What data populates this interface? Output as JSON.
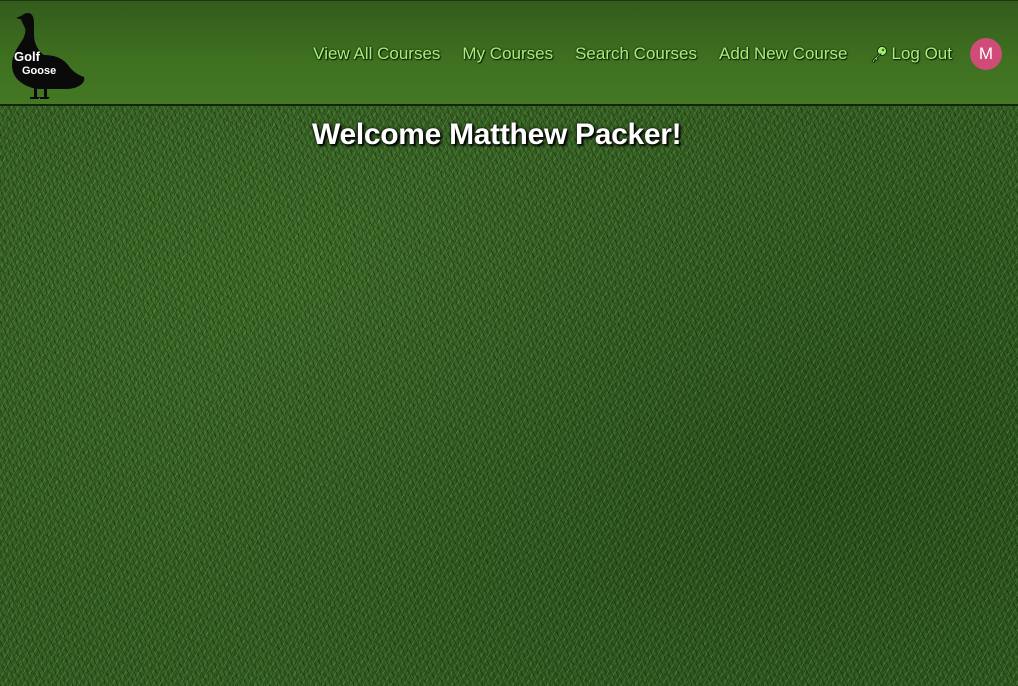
{
  "brand": {
    "logo_text_line1": "Golf",
    "logo_text_line2": "Goose"
  },
  "nav": {
    "items": [
      {
        "label": "View All Courses"
      },
      {
        "label": "My Courses"
      },
      {
        "label": "Search Courses"
      },
      {
        "label": "Add New Course"
      }
    ],
    "logout_label": "Log Out",
    "logout_icon": "key-icon",
    "avatar_initial": "M"
  },
  "main": {
    "welcome_text": "Welcome Matthew Packer!"
  },
  "colors": {
    "nav_background": "#3e7020",
    "nav_link": "#a6f07a",
    "avatar_background": "#cf4b78",
    "welcome_text": "#ffffff"
  }
}
